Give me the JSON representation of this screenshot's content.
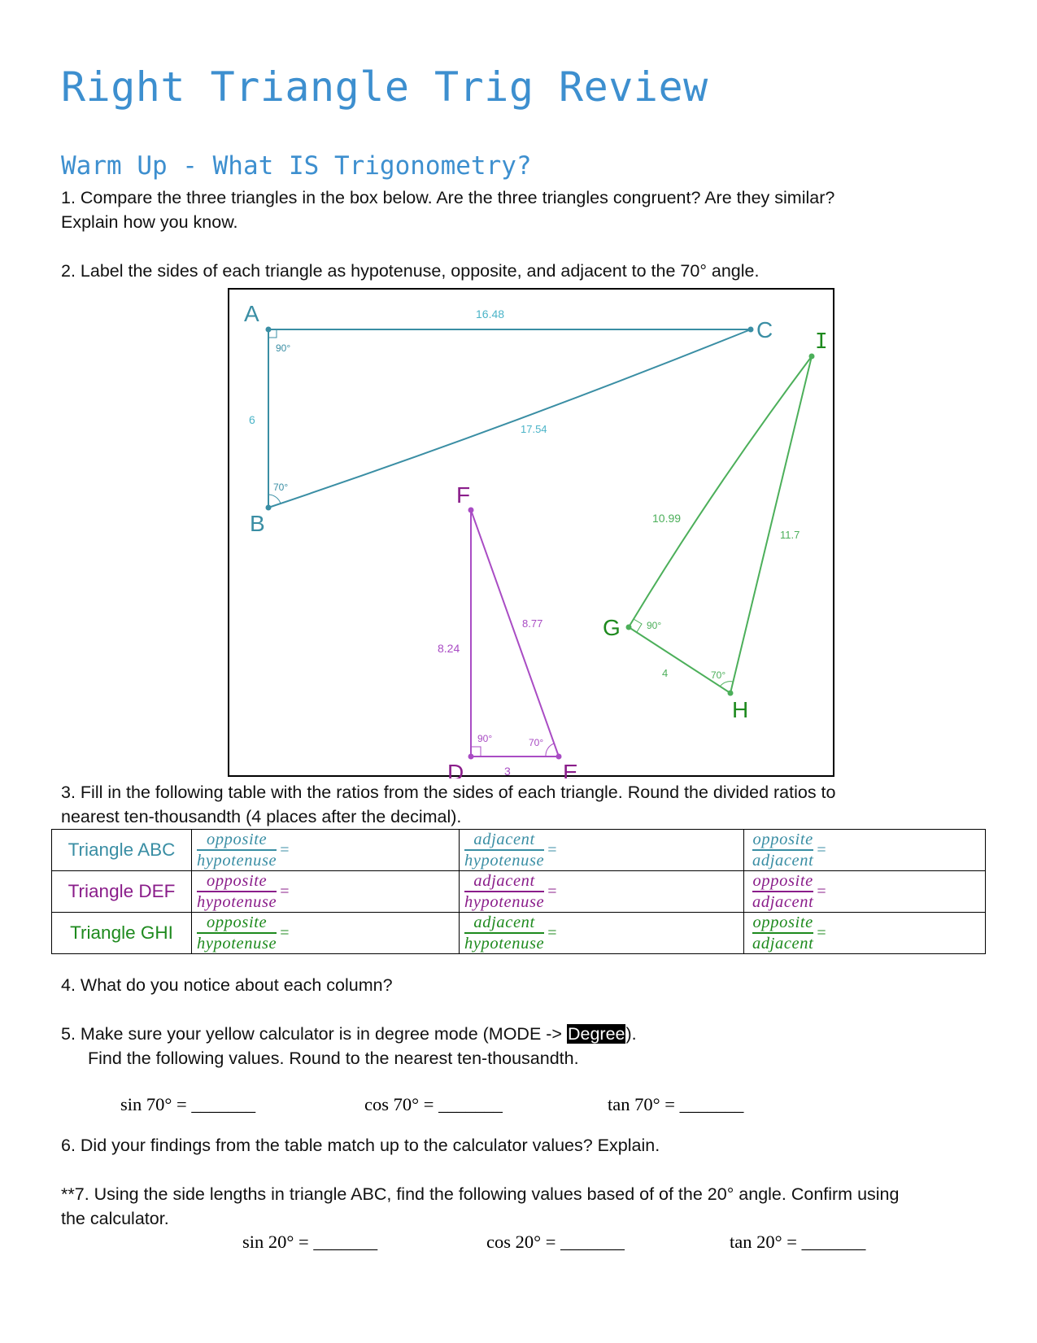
{
  "header": {
    "title": "Right Triangle Trig Review",
    "subtitle": "Warm Up - What IS Trigonometry?"
  },
  "questions": {
    "q1_line1": "1.  Compare the three triangles in the box below.  Are the three triangles congruent?  Are they similar?",
    "q1_line2": "Explain how you know.",
    "q2": "2.  Label the sides of each triangle as hypotenuse, opposite, and adjacent to the 70° angle.",
    "q3_line1": "3.  Fill in the following table with the ratios from the sides of each triangle.  Round the divided ratios to",
    "q3_line2": "nearest ten-thousandth (4 places after the decimal).",
    "q4": "4.  What do you notice about each column?",
    "q5_line1_pre": "5.  Make sure your yellow calculator is in degree mode (MODE -> ",
    "q5_highlight": "Degree",
    "q5_line1_post": ").",
    "q5_line2": "Find the following values.  Round to the nearest ten-thousandth.",
    "q6": "6.  Did your findings from the table match up to the calculator values?  Explain.",
    "q7_line1": "**7.  Using the side lengths in triangle ABC, find the following values based of of the 20° angle.  Confirm using",
    "q7_line2": "the calculator."
  },
  "calc70": [
    {
      "label": "sin 70° = ",
      "blank": "_______"
    },
    {
      "label": "cos 70° = ",
      "blank": "_______"
    },
    {
      "label": "tan 70° = ",
      "blank": "_______"
    }
  ],
  "calc20": [
    {
      "label": "sin 20° = ",
      "blank": "_______"
    },
    {
      "label": "cos 20° = ",
      "blank": "_______"
    },
    {
      "label": "tan 20° = ",
      "blank": "_______"
    }
  ],
  "colors": {
    "title": "#3d8fcf",
    "triangle_abc": "#3a8ea4",
    "triangle_def": "#a94cc4",
    "triangle_ghi": "#4caf5a",
    "label_abc": "#3a8ea4",
    "label_def": "#8a1d8a",
    "label_ghi": "#1e8a1e"
  },
  "diagram": {
    "triangles": [
      {
        "name": "ABC",
        "vertices": [
          {
            "label": "A",
            "angle": "90°"
          },
          {
            "label": "B",
            "angle": "70°"
          },
          {
            "label": "C",
            "angle": ""
          }
        ],
        "sides": [
          {
            "between": "AC",
            "length": "16.48"
          },
          {
            "between": "AB",
            "length": "6"
          },
          {
            "between": "BC",
            "length": "17.54"
          }
        ]
      },
      {
        "name": "DEF",
        "vertices": [
          {
            "label": "D",
            "angle": "90°"
          },
          {
            "label": "E",
            "angle": "70°"
          },
          {
            "label": "F",
            "angle": ""
          }
        ],
        "sides": [
          {
            "between": "DF",
            "length": "8.24"
          },
          {
            "between": "EF",
            "length": "8.77"
          },
          {
            "between": "DE",
            "length": "3"
          }
        ]
      },
      {
        "name": "GHI",
        "vertices": [
          {
            "label": "G",
            "angle": "90°"
          },
          {
            "label": "H",
            "angle": "70°"
          },
          {
            "label": "I",
            "angle": ""
          }
        ],
        "sides": [
          {
            "between": "GI",
            "length": "10.99"
          },
          {
            "between": "HI",
            "length": "11.7"
          },
          {
            "between": "GH",
            "length": "4"
          }
        ]
      }
    ]
  },
  "table": {
    "rows": [
      {
        "label": "Triangle ABC",
        "cells": [
          {
            "num": "opposite",
            "den": "hypotenuse",
            "eq": "="
          },
          {
            "num": "adjacent",
            "den": "hypotenuse",
            "eq": "="
          },
          {
            "num": "opposite",
            "den": "adjacent",
            "eq": "="
          }
        ]
      },
      {
        "label": "Triangle DEF",
        "cells": [
          {
            "num": "opposite",
            "den": "hypotenuse",
            "eq": "="
          },
          {
            "num": "adjacent",
            "den": "hypotenuse",
            "eq": "="
          },
          {
            "num": "opposite",
            "den": "adjacent",
            "eq": "="
          }
        ]
      },
      {
        "label": "Triangle GHI",
        "cells": [
          {
            "num": "opposite",
            "den": "hypotenuse",
            "eq": "="
          },
          {
            "num": "adjacent",
            "den": "hypotenuse",
            "eq": "="
          },
          {
            "num": "opposite",
            "den": "adjacent",
            "eq": "="
          }
        ]
      }
    ]
  }
}
